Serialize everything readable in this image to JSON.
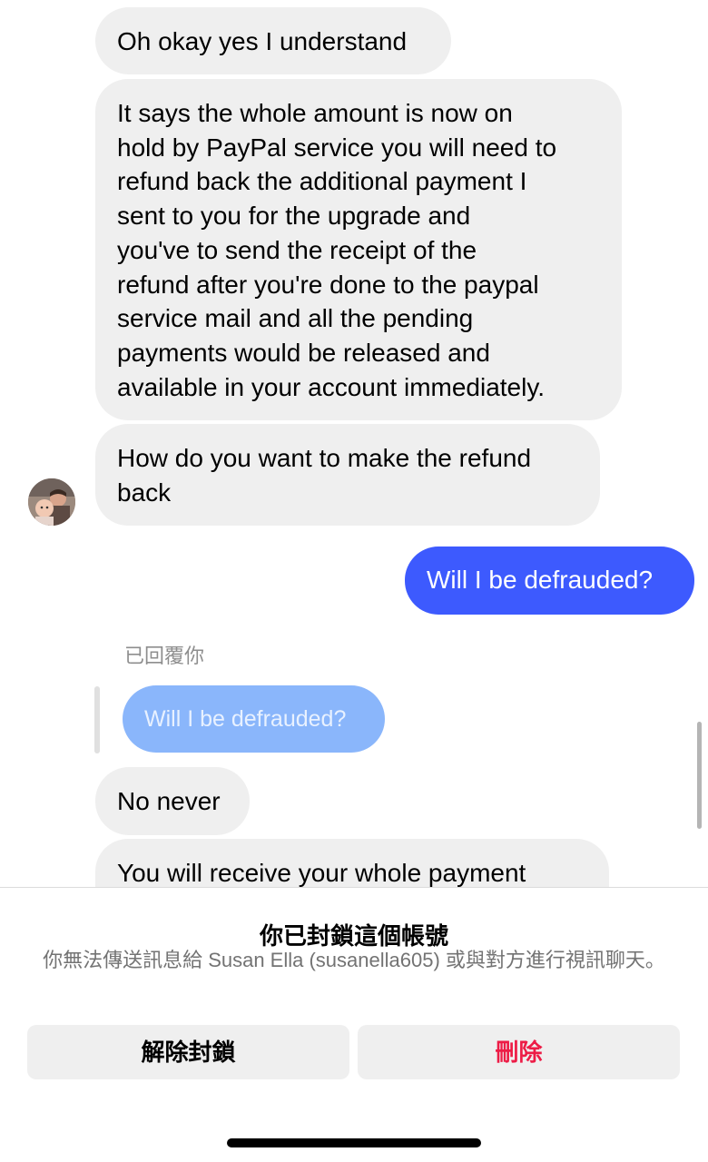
{
  "messages": [
    {
      "direction": "incoming",
      "text": "Oh okay yes I understand"
    },
    {
      "direction": "incoming",
      "text": "It says the whole amount is now on\nhold by PayPal service you will need to\nrefund back the additional payment I\nsent to you for the upgrade and\nyou've to send the receipt of the\nrefund after you're done to the paypal\nservice mail and all the pending\npayments would be released and\navailable in your account immediately."
    },
    {
      "direction": "incoming",
      "text": "How do you want to make the refund\nback"
    },
    {
      "direction": "outgoing",
      "text": "Will I be defrauded?"
    },
    {
      "direction": "incoming",
      "text": "No never"
    },
    {
      "direction": "incoming",
      "text": "You will receive your whole payment"
    }
  ],
  "reply": {
    "label": "已回覆你",
    "quoted_text": "Will I be defrauded?"
  },
  "blocked_panel": {
    "title": "你已封鎖這個帳號",
    "description": "你無法傳送訊息給 Susan Ella (susanella605) 或與對方進行視訊聊天。",
    "unblock_label": "解除封鎖",
    "delete_label": "刪除"
  },
  "colors": {
    "outgoing_bubble": "#3d5afe",
    "incoming_bubble": "#efefef",
    "delete_text": "#ed1c46"
  }
}
